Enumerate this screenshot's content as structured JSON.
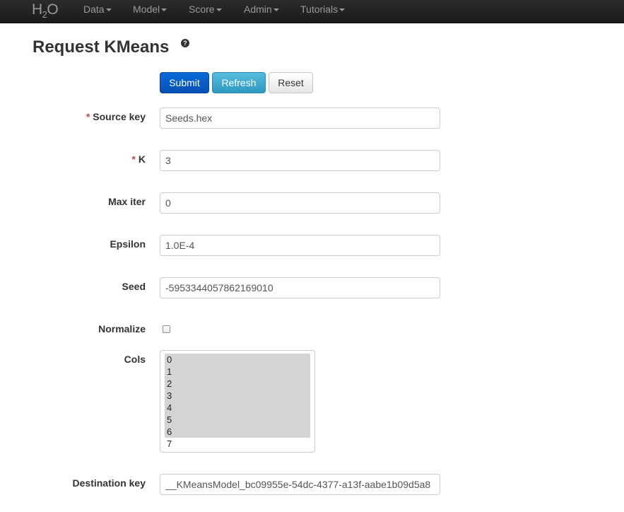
{
  "navbar": {
    "brand_main": "H",
    "brand_sub": "2",
    "brand_end": "O",
    "items": [
      {
        "label": "Data"
      },
      {
        "label": "Model"
      },
      {
        "label": "Score"
      },
      {
        "label": "Admin"
      },
      {
        "label": "Tutorials"
      }
    ]
  },
  "page": {
    "title": "Request KMeans",
    "help_icon": "question-icon",
    "help_glyph": "?"
  },
  "buttons": {
    "submit": "Submit",
    "refresh": "Refresh",
    "reset": "Reset"
  },
  "form": {
    "required_marker": "*",
    "source_key": {
      "label": "Source key",
      "value": "Seeds.hex"
    },
    "k": {
      "label": "K",
      "value": "3"
    },
    "max_iter": {
      "label": "Max iter",
      "value": "0"
    },
    "epsilon": {
      "label": "Epsilon",
      "value": "1.0E-4"
    },
    "seed": {
      "label": "Seed",
      "value": "-5953344057862169010"
    },
    "normalize": {
      "label": "Normalize",
      "checked": false
    },
    "cols": {
      "label": "Cols",
      "options": [
        {
          "label": "0",
          "selected": true
        },
        {
          "label": "1",
          "selected": true
        },
        {
          "label": "2",
          "selected": true
        },
        {
          "label": "3",
          "selected": true
        },
        {
          "label": "4",
          "selected": true
        },
        {
          "label": "5",
          "selected": true
        },
        {
          "label": "6",
          "selected": true
        },
        {
          "label": "7",
          "selected": false
        }
      ]
    },
    "destination_key": {
      "label": "Destination key",
      "value": "__KMeansModel_bc09955e-54dc-4377-a13f-aabe1b09d5a8"
    }
  },
  "colors": {
    "navbar_bg": "#1b1b1b",
    "primary": "#0450b5",
    "info": "#2f99c2",
    "required": "#b94a48",
    "selected_option": "#d4d4d4"
  }
}
